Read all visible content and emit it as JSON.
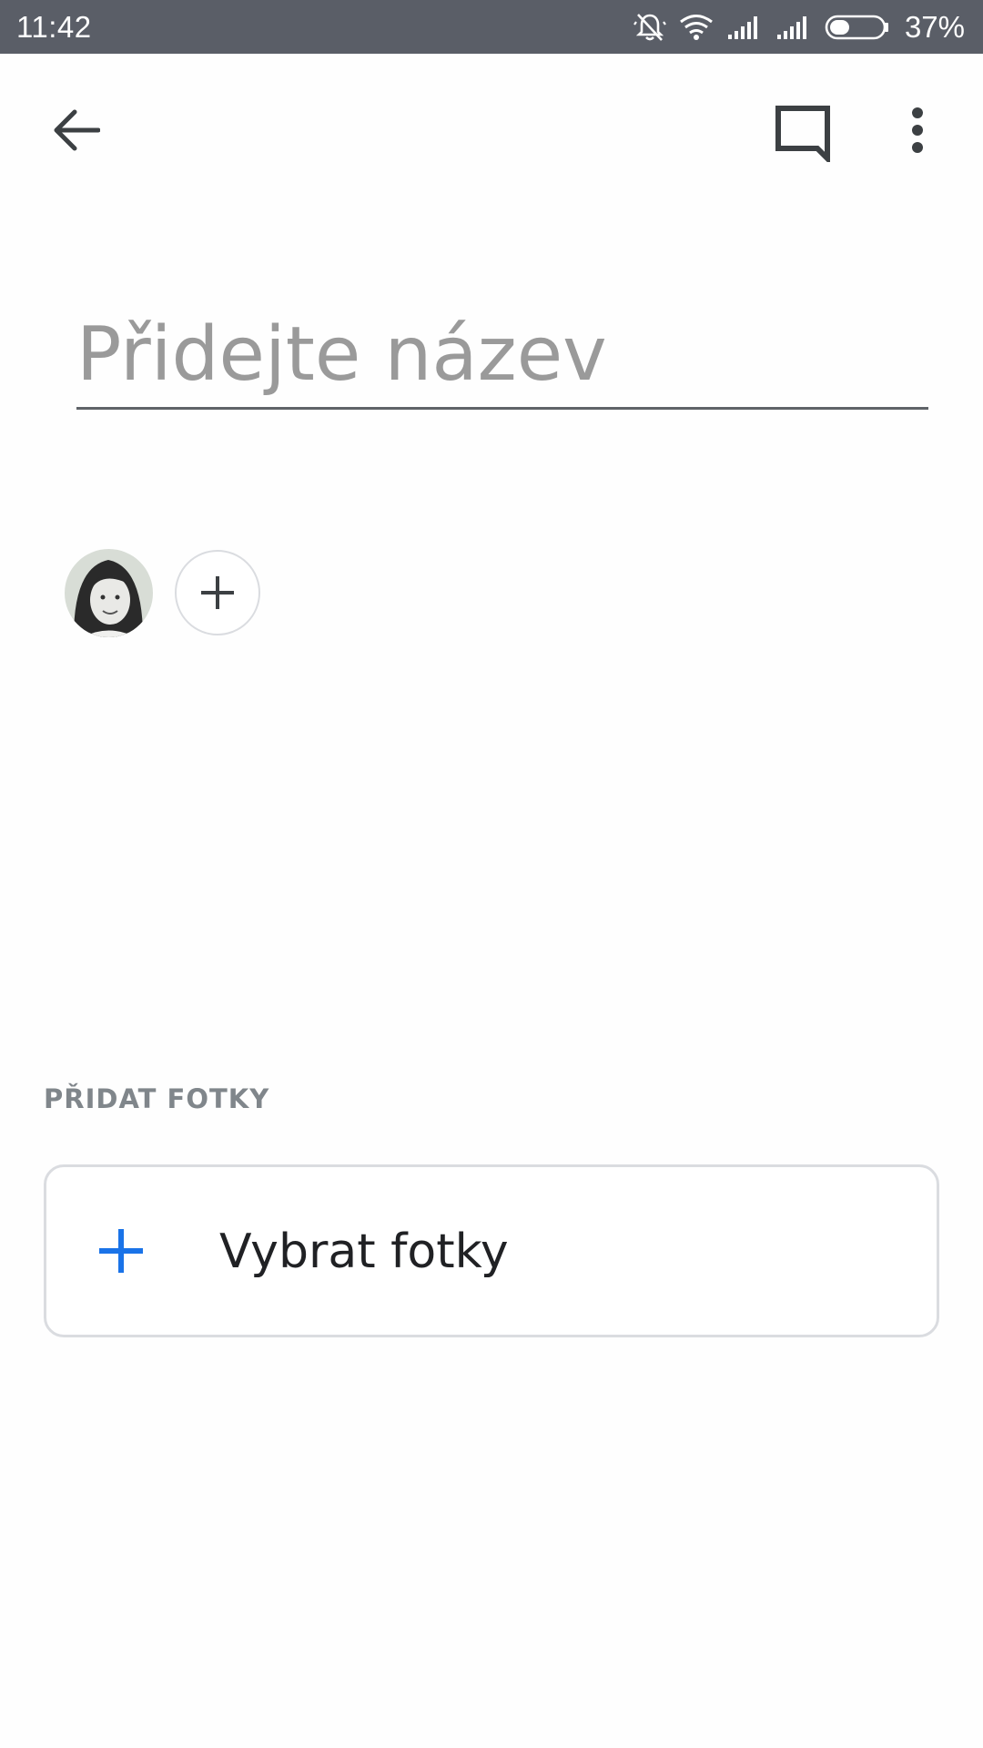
{
  "status_bar": {
    "time": "11:42",
    "battery_percent": "37%",
    "battery_level": 0.37,
    "icons": [
      "notifications-muted-icon",
      "wifi-icon",
      "signal-icon",
      "signal-icon",
      "battery-icon"
    ]
  },
  "app_bar": {
    "icons": [
      "back-arrow-icon",
      "comment-icon",
      "more-vert-icon"
    ]
  },
  "title_field": {
    "value": "",
    "placeholder": "Přidejte název"
  },
  "people": {
    "avatar_icon": "user-avatar",
    "add_icon": "plus-icon"
  },
  "add_photos": {
    "section_label": "PŘIDAT FOTKY",
    "button_label": "Vybrat fotky",
    "button_icon": "plus-icon",
    "accent_color": "#1a73e8"
  },
  "colors": {
    "status_bar": "#5a5e67",
    "text_primary": "#202124",
    "text_secondary": "#80868b",
    "placeholder": "#9a9a9a",
    "border": "#dadce0"
  }
}
